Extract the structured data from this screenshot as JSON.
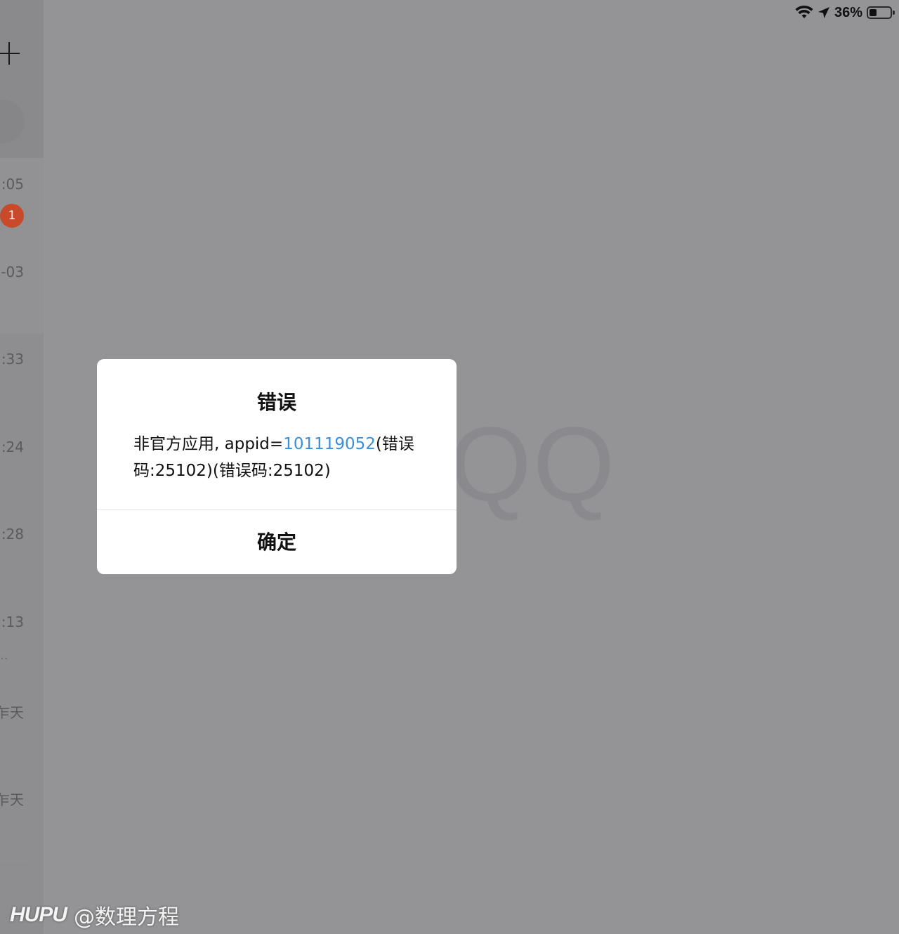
{
  "status_bar": {
    "wifi_icon": "wifi-icon",
    "location_icon": "location-arrow-icon",
    "battery_percent": "36%",
    "battery_level": 0.36
  },
  "sidebar": {
    "add_icon": "plus-icon",
    "items": [
      {
        "time": ":05",
        "unread": "1"
      },
      {
        "time": "-03"
      },
      {
        "time": ":33"
      },
      {
        "time": ":24"
      },
      {
        "time": ":28"
      },
      {
        "time": "):13",
        "snippet": ".."
      },
      {
        "time": "乍天"
      },
      {
        "time": "乍天"
      }
    ]
  },
  "background": {
    "logo_text": "QQ"
  },
  "dialog": {
    "title": "错误",
    "message_prefix": "非官方应用, appid=",
    "appid": "101119052",
    "message_suffix": "(错误码:25102)(错误码:25102)",
    "confirm_label": "确定",
    "link_color": "#3a8fdb"
  },
  "watermark": {
    "logo": "HUPU",
    "handle": "@数理方程"
  }
}
